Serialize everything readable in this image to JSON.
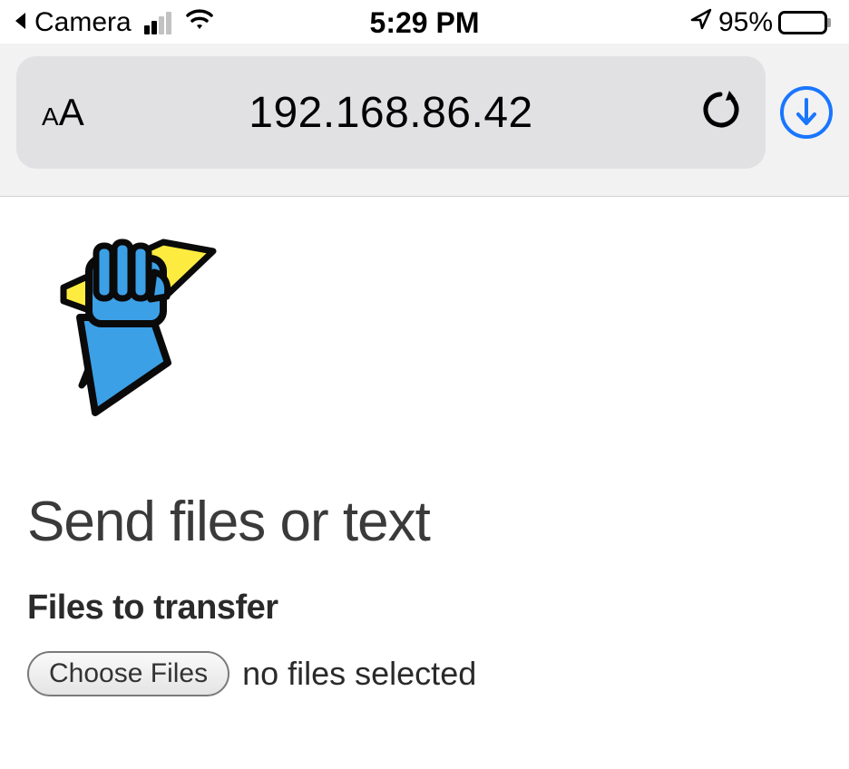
{
  "status": {
    "back_app": "Camera",
    "time": "5:29 PM",
    "battery_percent": "95%"
  },
  "browser": {
    "text_size_label": "AA",
    "address": "192.168.86.42"
  },
  "page": {
    "heading": "Send files or text",
    "subheading": "Files to transfer",
    "choose_label": "Choose Files",
    "file_status": "no files selected"
  },
  "icons": {
    "back_arrow": "back-arrow-icon",
    "signal": "signal-bars-icon",
    "wifi": "wifi-icon",
    "location": "location-arrow-icon",
    "battery": "battery-icon",
    "reload": "reload-icon",
    "download": "download-arrow-icon",
    "app_logo": "fist-lightning-logo-icon"
  }
}
